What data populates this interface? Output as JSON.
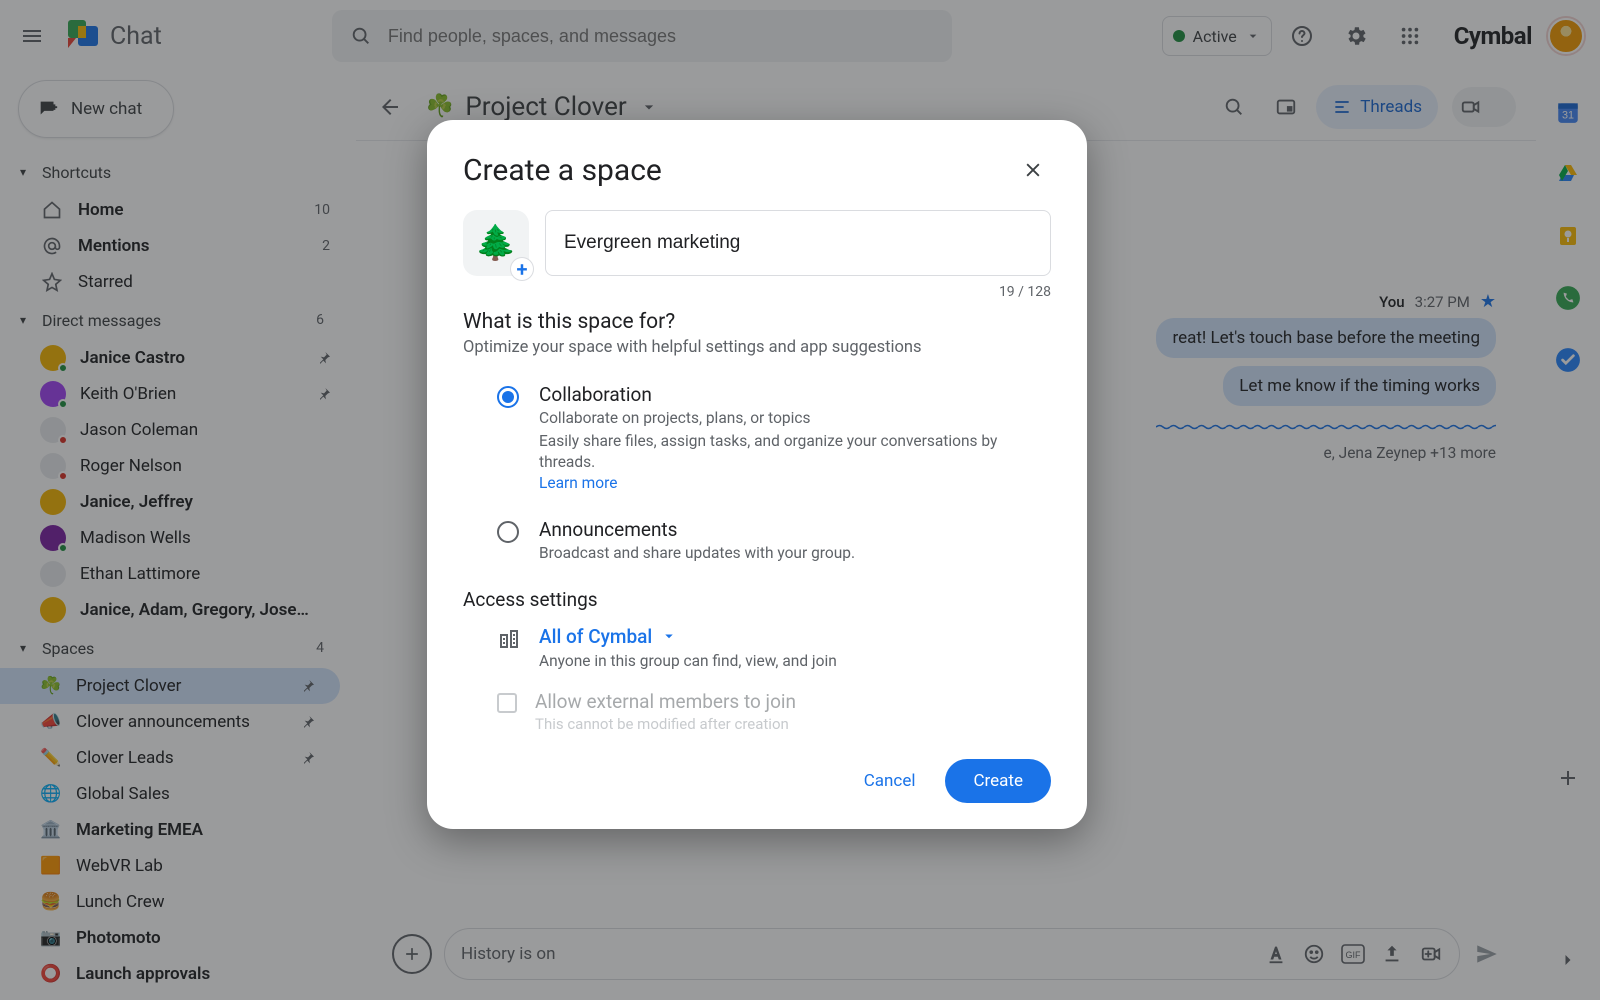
{
  "header": {
    "app_name": "Chat",
    "search_placeholder": "Find people, spaces, and messages",
    "status_label": "Active",
    "brand": "Cymbal"
  },
  "sidebar": {
    "new_chat": "New chat",
    "sections": {
      "shortcuts": {
        "label": "Shortcuts"
      },
      "home": {
        "label": "Home",
        "count": "10"
      },
      "mentions": {
        "label": "Mentions",
        "count": "2"
      },
      "starred": {
        "label": "Starred"
      },
      "dm_header": {
        "label": "Direct messages",
        "count": "6"
      },
      "spaces_header": {
        "label": "Spaces",
        "count": "4"
      }
    },
    "dms": [
      {
        "name": "Janice Castro",
        "bold": true,
        "pinned": true,
        "color": "#f4b400",
        "presence": "#1e8e3e"
      },
      {
        "name": "Keith O'Brien",
        "bold": false,
        "pinned": true,
        "color": "#a142f4",
        "presence": "#1e8e3e"
      },
      {
        "name": "Jason Coleman",
        "bold": false,
        "pinned": false,
        "color": "#e8eaed",
        "presence": "#d93025"
      },
      {
        "name": "Roger Nelson",
        "bold": false,
        "pinned": false,
        "color": "#e8eaed",
        "presence": "#d93025"
      },
      {
        "name": "Janice, Jeffrey",
        "bold": true,
        "pinned": false,
        "color": "#f4b400",
        "presence": ""
      },
      {
        "name": "Madison Wells",
        "bold": false,
        "pinned": false,
        "color": "#7b1fa2",
        "presence": "#1e8e3e"
      },
      {
        "name": "Ethan Lattimore",
        "bold": false,
        "pinned": false,
        "color": "#e8eaed",
        "presence": ""
      },
      {
        "name": "Janice, Adam, Gregory, Jose…",
        "bold": true,
        "pinned": false,
        "color": "#f4b400",
        "presence": ""
      }
    ],
    "spaces": [
      {
        "emoji": "☘️",
        "name": "Project Clover",
        "bold": false,
        "pinned": true,
        "active": true
      },
      {
        "emoji": "📣",
        "name": "Clover announcements",
        "bold": false,
        "pinned": true,
        "active": false
      },
      {
        "emoji": "✏️",
        "name": "Clover Leads",
        "bold": false,
        "pinned": true,
        "active": false
      },
      {
        "emoji": "🌐",
        "name": "Global Sales",
        "bold": false,
        "pinned": false,
        "active": false
      },
      {
        "emoji": "🏛️",
        "name": "Marketing EMEA",
        "bold": true,
        "pinned": false,
        "active": false
      },
      {
        "emoji": "🟧",
        "name": "WebVR Lab",
        "bold": false,
        "pinned": false,
        "active": false
      },
      {
        "emoji": "🍔",
        "name": "Lunch Crew",
        "bold": false,
        "pinned": false,
        "active": false
      },
      {
        "emoji": "📷",
        "name": "Photomoto",
        "bold": true,
        "pinned": false,
        "active": false
      },
      {
        "emoji": "⭕",
        "name": "Launch approvals",
        "bold": true,
        "pinned": false,
        "active": false
      }
    ]
  },
  "room": {
    "emoji": "☘️",
    "title": "Project Clover",
    "threads_label": "Threads"
  },
  "messages": {
    "you_label": "You",
    "time": "3:27 PM",
    "line1": "reat! Let's touch base before the meeting",
    "line2": "Let me know if the timing works",
    "seen": "e, Jena Zeynep +13 more"
  },
  "composer": {
    "placeholder": "History is on"
  },
  "dialog": {
    "title": "Create a space",
    "tree_emoji": "🌲",
    "name_value": "Evergreen marketing",
    "counter": "19 / 128",
    "question": "What is this space for?",
    "question_sub": "Optimize your space with helpful settings and app suggestions",
    "opt1": {
      "title": "Collaboration",
      "line1": "Collaborate on projects, plans, or topics",
      "line2": "Easily share files, assign tasks, and organize your conversations by threads.",
      "learn": "Learn more"
    },
    "opt2": {
      "title": "Announcements",
      "desc": "Broadcast and share updates with your group."
    },
    "access_title": "Access settings",
    "access_value": "All of Cymbal",
    "access_desc": "Anyone in this group can find, view, and join",
    "external_title": "Allow external members to join",
    "external_desc": "This cannot be modified after creation",
    "cancel": "Cancel",
    "create": "Create"
  }
}
